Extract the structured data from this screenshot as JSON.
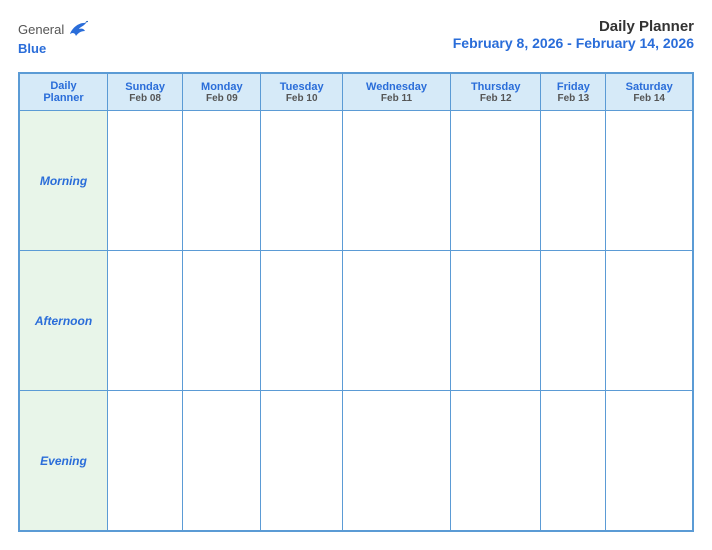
{
  "header": {
    "logo": {
      "general": "General",
      "blue": "Blue"
    },
    "title": "Daily Planner",
    "date_range": "February 8, 2026 - February 14, 2026"
  },
  "calendar": {
    "label_header_line1": "Daily",
    "label_header_line2": "Planner",
    "days": [
      {
        "name": "Sunday",
        "date": "Feb 08"
      },
      {
        "name": "Monday",
        "date": "Feb 09"
      },
      {
        "name": "Tuesday",
        "date": "Feb 10"
      },
      {
        "name": "Wednesday",
        "date": "Feb 11"
      },
      {
        "name": "Thursday",
        "date": "Feb 12"
      },
      {
        "name": "Friday",
        "date": "Feb 13"
      },
      {
        "name": "Saturday",
        "date": "Feb 14"
      }
    ],
    "rows": [
      {
        "label": "Morning"
      },
      {
        "label": "Afternoon"
      },
      {
        "label": "Evening"
      }
    ]
  }
}
